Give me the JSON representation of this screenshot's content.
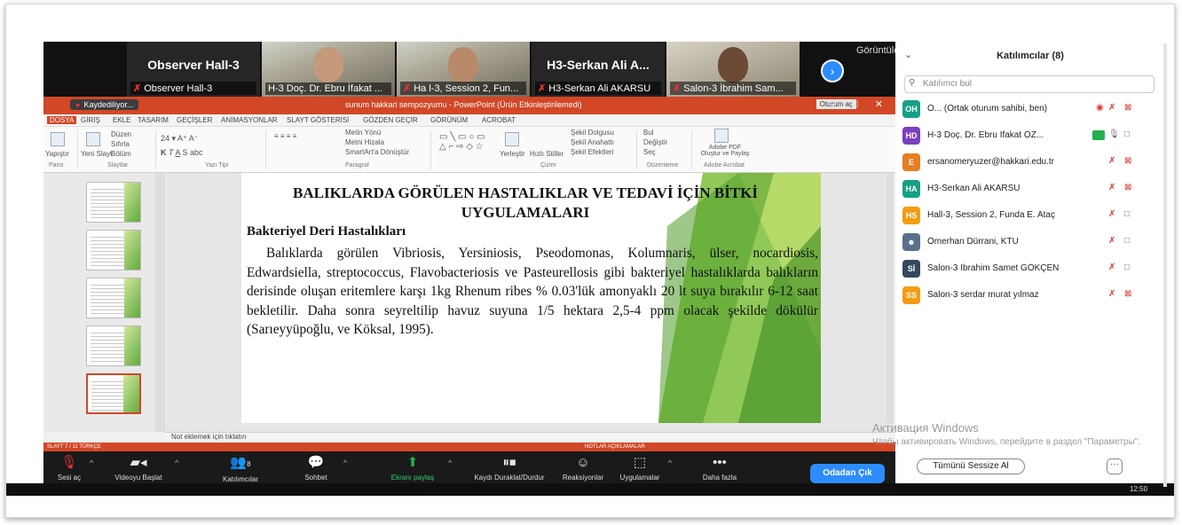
{
  "video_strip": {
    "tiles": [
      {
        "name": "Observer Hall-3",
        "label": "Observer Hall-3"
      },
      {
        "name": "",
        "label": "H-3 Doç. Dr. Ebru İfakat ..."
      },
      {
        "name": "",
        "label": "Ha  l-3, Session 2, Fun..."
      },
      {
        "name": "H3-Serkan Ali A...",
        "label": "H3-Serkan Ali AKARSU"
      },
      {
        "name": "",
        "label": "Salon-3 İbrahim Sam..."
      }
    ],
    "view_label": "Görüntüle",
    "next_icon": "chevron-right-icon"
  },
  "powerpoint": {
    "recording_label": "Kaydediliyor...",
    "doc_title": "sunum hakkari sempozyumu - PowerPoint (Ürün Etkinleştirilemedi)",
    "oturum_btn": "Oturum aç",
    "tabs": [
      "DOSYA",
      "GİRİŞ",
      "EKLE",
      "TASARIM",
      "GEÇİŞLER",
      "ANİMASYONLAR",
      "SLAYT GÖSTERİSİ",
      "GÖZDEN GEÇİR",
      "GÖRÜNÜM",
      "ACROBAT"
    ],
    "ribbon_groups": [
      "Pano",
      "Slaytlar",
      "Yazı Tipi",
      "Paragraf",
      "Çizim",
      "Düzenleme",
      "Adobe Acrobat"
    ],
    "ribbon_items": {
      "yapistir": "Yapıştır",
      "yeni_slayt": "Yeni Slayt",
      "duzen": "Düzen",
      "sifirla": "Sıfırla",
      "bolum": "Bölüm",
      "metin_yonu": "Metin Yönü",
      "metni_hizala": "Metni Hizala",
      "smartart": "SmartArt'a Dönüştür",
      "yerlestir": "Yerleştir",
      "hizli_stiller": "Hızlı Stiller",
      "sekil_dolgusu": "Şekil Dolgusu",
      "sekil_anahatti": "Şekil Anahattı",
      "sekil_efektleri": "Şekil Efektleri",
      "bul": "Bul",
      "degistir": "Değiştir",
      "sec": "Seç",
      "adobe_pdf": "Adobe PDF Oluştur ve Paylaş"
    },
    "slide": {
      "title": "BALIKLARDA GÖRÜLEN HASTALIKLAR VE TEDAVİ İÇİN BİTKİ UYGULAMALARI",
      "subtitle": "Bakteriyel Deri Hastalıkları",
      "body": "Balıklarda görülen Vibriosis, Yersiniosis, Pseodomonas, Kolumnaris, ülser, nocardiosis, Edwardsiella, streptococcus, Flavobacteriosis ve Pasteurellosis gibi bakteriyel hastalıklarda balıkların derisinde oluşan eritemlere karşı 1kg Rhenum ribes % 0.03'lük amonyaklı 20 lt suya bırakılır 6-12 saat bekletilir. Daha sonra seyreltilip havuz suyuna 1/5 hektara 2,5-4 ppm olacak şekilde dökülür (Sarıeyyüpoğlu, ve Köksal, 1995)."
    },
    "notes_placeholder": "Not eklemek için tıklatın",
    "status_left": "SLAYT 7 / 11   TÜRKÇE",
    "status_right": "NOTLAR   AÇIKLAMALAR"
  },
  "toolbar": {
    "items": [
      {
        "label": "Sesi aç",
        "icon": "microphone-off-icon"
      },
      {
        "label": "Videoyu Başlat",
        "icon": "video-off-icon"
      },
      {
        "label": "Katılımcılar",
        "icon": "participants-icon",
        "count": "8"
      },
      {
        "label": "Sohbet",
        "icon": "chat-icon"
      },
      {
        "label": "Ekranı paylaş",
        "icon": "share-screen-icon"
      },
      {
        "label": "Kaydı Duraklat/Durdur",
        "icon": "pause-stop-icon"
      },
      {
        "label": "Reaksiyonlar",
        "icon": "reaction-icon"
      },
      {
        "label": "Uygulamalar",
        "icon": "apps-icon"
      },
      {
        "label": "Daha fazla",
        "icon": "more-icon"
      }
    ],
    "end_label": "Odadan Çık"
  },
  "participants": {
    "title": "Katılımcılar (8)",
    "search_placeholder": "Katılımcı bul",
    "list": [
      {
        "initials": "OH",
        "name": "O... (Ortak oturum sahibi, ben)",
        "color": "#16a085"
      },
      {
        "initials": "HD",
        "name": "H-3 Doç. Dr. Ebru İfakat ÖZ...",
        "color": "#7b3fbf"
      },
      {
        "initials": "E",
        "name": "ersanomeryuzer@hakkari.edu.tr",
        "color": "#e67e22"
      },
      {
        "initials": "HA",
        "name": "H3-Serkan Ali AKARSU",
        "color": "#16a085"
      },
      {
        "initials": "HS",
        "name": "Hall-3, Session 2, Funda E. Ataç",
        "color": "#f39c12"
      },
      {
        "initials": "",
        "name": "Ömerhan Dürrani, KTU",
        "color": "#5a6f8a"
      },
      {
        "initials": "Sİ",
        "name": "Salon-3 İbrahim Samet GÖKÇEN",
        "color": "#34495e"
      },
      {
        "initials": "SS",
        "name": "Salon-3 serdar murat yılmaz",
        "color": "#f39c12"
      }
    ],
    "mute_all": "Tümünü Sessize Al",
    "more": "···"
  },
  "windows": {
    "watermark_title": "Активация Windows",
    "watermark_sub": "Чтобы активировать Windows, перейдите в раздел \"Параметры\".",
    "clock": "12:50"
  }
}
